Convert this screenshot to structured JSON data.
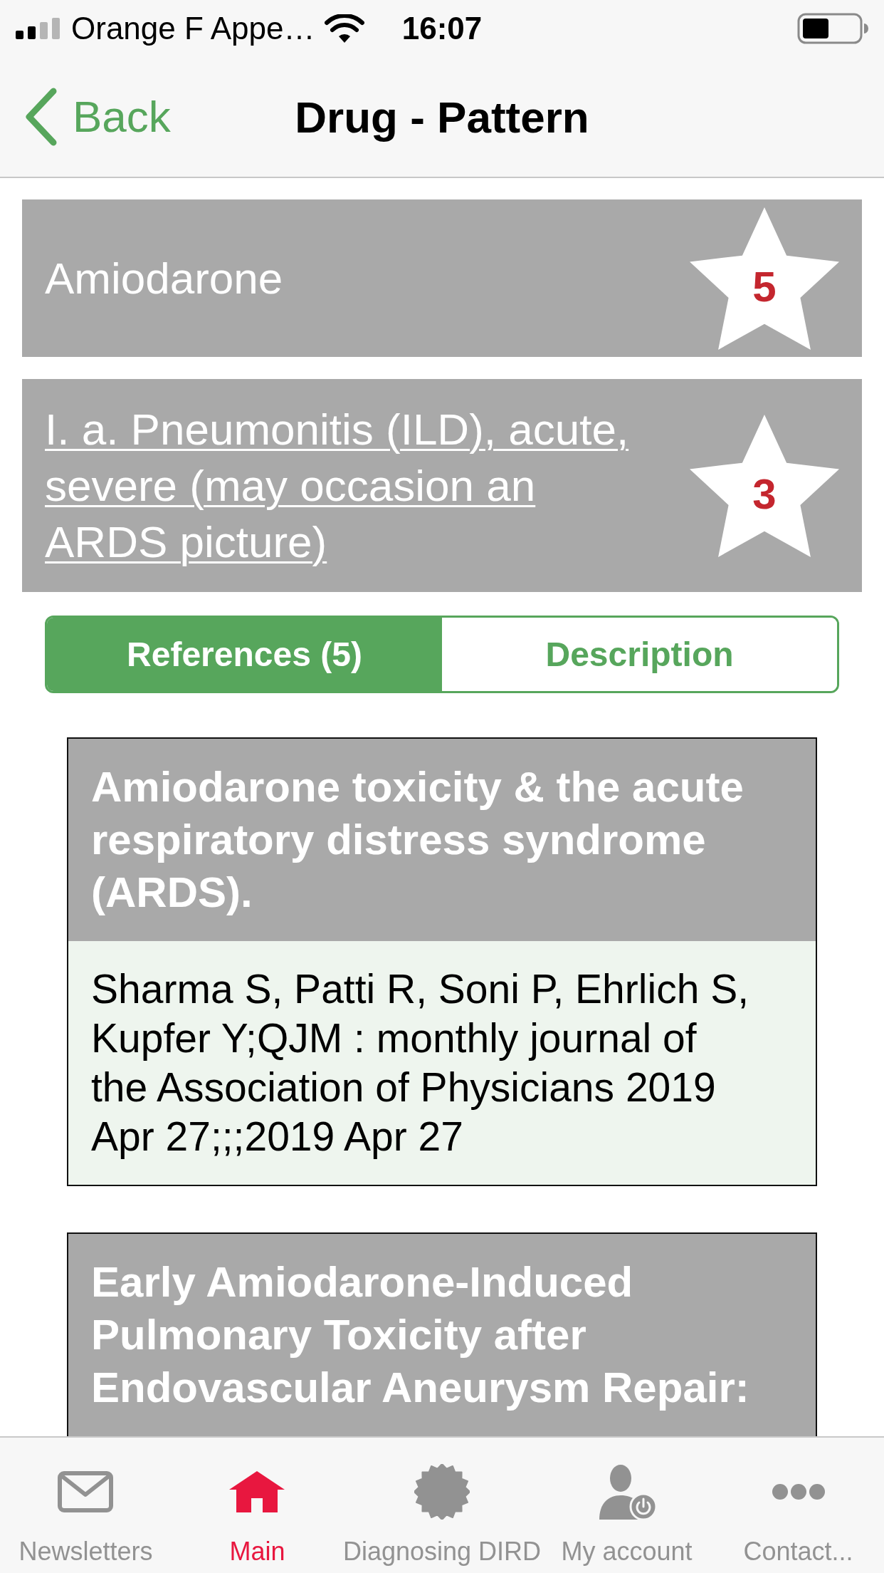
{
  "status_bar": {
    "carrier": "Orange F Appe…",
    "time": "16:07"
  },
  "nav_bar": {
    "back": "Back",
    "title": "Drug - Pattern"
  },
  "cards": [
    {
      "kind": "plain",
      "text": "Amiodarone",
      "badge": "5"
    },
    {
      "kind": "link",
      "text": "I. a. Pneumonitis (ILD), acute, severe (may occasion an ARDS picture)",
      "badge": "3"
    }
  ],
  "segments": [
    {
      "label": "References (5)",
      "selected": true
    },
    {
      "label": "Description",
      "selected": false
    }
  ],
  "references": [
    {
      "title": "Amiodarone toxicity & the acute respiratory distress syndrome (ARDS).",
      "citation": "Sharma S, Patti R, Soni P, Ehrlich S, Kupfer Y;QJM : monthly journal of the Association of Physicians 2019 Apr 27;;;2019 Apr 27"
    },
    {
      "title": "Early Amiodarone-Induced Pulmonary Toxicity after Endovascular Aneurysm Repair:"
    }
  ],
  "tab_bar": {
    "items": [
      {
        "label": "Newsletters",
        "selected": false
      },
      {
        "label": "Main",
        "selected": true
      },
      {
        "label": "Diagnosing DIRD",
        "selected": false
      },
      {
        "label": "My account",
        "selected": false
      },
      {
        "label": "Contact...",
        "selected": false
      }
    ]
  }
}
